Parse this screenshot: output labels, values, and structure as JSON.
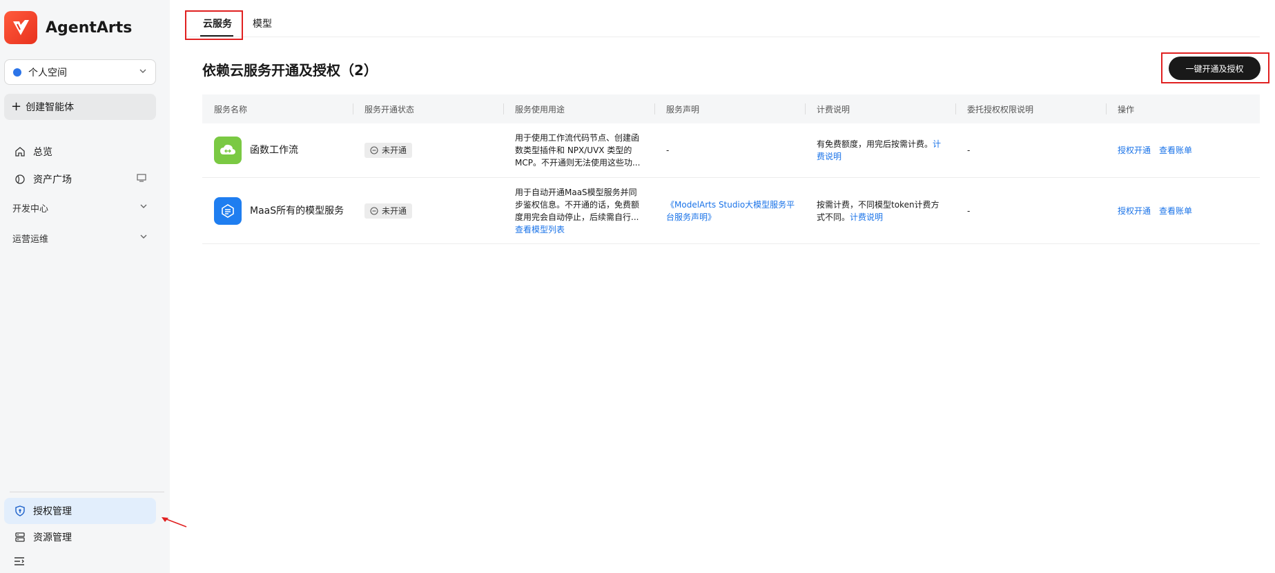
{
  "brand": {
    "name": "AgentArts",
    "accent": "#e8321e"
  },
  "sidebar": {
    "workspace": "个人空间",
    "create": "创建智能体",
    "items": [
      {
        "label": "总览",
        "icon": "home-icon"
      },
      {
        "label": "资产广场",
        "icon": "asset-icon"
      }
    ],
    "groups": [
      {
        "label": "开发中心"
      },
      {
        "label": "运营运维"
      }
    ],
    "bottom": [
      {
        "label": "授权管理",
        "icon": "shield-icon",
        "active": true
      },
      {
        "label": "资源管理",
        "icon": "resource-icon"
      }
    ]
  },
  "tabs": [
    {
      "label": "云服务",
      "active": true
    },
    {
      "label": "模型"
    }
  ],
  "section": {
    "title": "依赖云服务开通及授权（2）",
    "primary_button": "一键开通及授权"
  },
  "table": {
    "headers": [
      "服务名称",
      "服务开通状态",
      "服务使用用途",
      "服务声明",
      "计费说明",
      "委托授权权限说明",
      "操作"
    ],
    "rows": [
      {
        "name": "函数工作流",
        "status": "未开通",
        "usage": "用于使用工作流代码节点、创建函数类型插件和 NPX/UVX 类型的 MCP。不开通则无法使用这些功...",
        "usage_link": "",
        "statement": "-",
        "billing": "有免费额度，用完后按需计费。",
        "billing_link": "计费说明",
        "delegation": "-",
        "op1": "授权开通",
        "op2": "查看账单"
      },
      {
        "name": "MaaS所有的模型服务",
        "status": "未开通",
        "usage": "用于自动开通MaaS模型服务并同步鉴权信息。不开通的话，免费额度用完会自动停止，后续需自行...",
        "usage_link": "查看模型列表",
        "statement": "《ModelArts Studio大模型服务平台服务声明》",
        "billing": "按需计费，不同模型token计费方式不同。",
        "billing_link": "计费说明",
        "delegation": "-",
        "op1": "授权开通",
        "op2": "查看账单"
      }
    ]
  }
}
